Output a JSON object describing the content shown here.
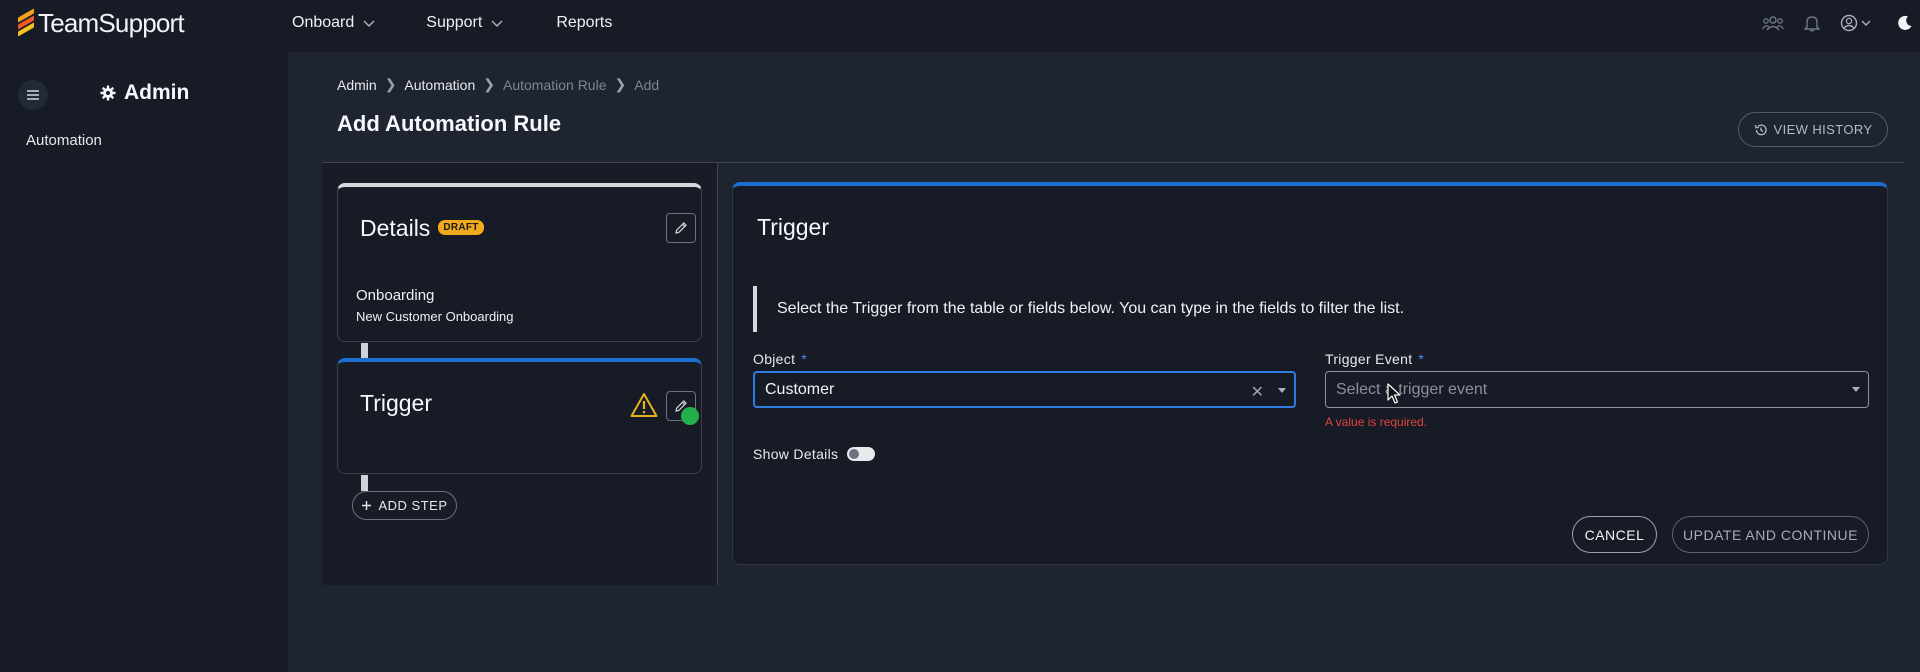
{
  "brand": {
    "name": "TeamSupport"
  },
  "nav": {
    "items": [
      {
        "label": "Onboard",
        "has_dropdown": true
      },
      {
        "label": "Support",
        "has_dropdown": true
      },
      {
        "label": "Reports",
        "has_dropdown": false
      }
    ],
    "right_icons": [
      "team-icon",
      "bell-icon",
      "user-circle-icon",
      "moon-icon"
    ]
  },
  "sidebar": {
    "title": "Admin",
    "title_icon": "gear-icon",
    "items": [
      {
        "label": "Automation"
      }
    ]
  },
  "breadcrumb": [
    "Admin",
    "Automation",
    "Automation Rule",
    "Add"
  ],
  "page": {
    "title": "Add Automation Rule",
    "view_history_label": "VIEW HISTORY"
  },
  "steps": {
    "details": {
      "title": "Details",
      "badge": "DRAFT",
      "name": "Onboarding",
      "description": "New Customer Onboarding"
    },
    "trigger": {
      "title": "Trigger",
      "warning_icon": "warning-icon"
    },
    "add_step_label": "ADD STEP"
  },
  "trigger_form": {
    "title": "Trigger",
    "info": "Select the Trigger from the table or fields below. You can type in the fields to filter the list.",
    "object": {
      "label": "Object",
      "required": "*",
      "value": "Customer"
    },
    "event": {
      "label": "Trigger Event",
      "required": "*",
      "placeholder": "Select a trigger event",
      "error": "A value is required."
    },
    "show_details": {
      "label": "Show Details",
      "on": false
    },
    "cancel_label": "CANCEL",
    "update_label": "UPDATE AND CONTINUE"
  },
  "colors": {
    "accent": "#1a6fd1",
    "draft_badge": "#f1a91d",
    "error": "#e0443c",
    "success_dot": "#22b04a"
  }
}
